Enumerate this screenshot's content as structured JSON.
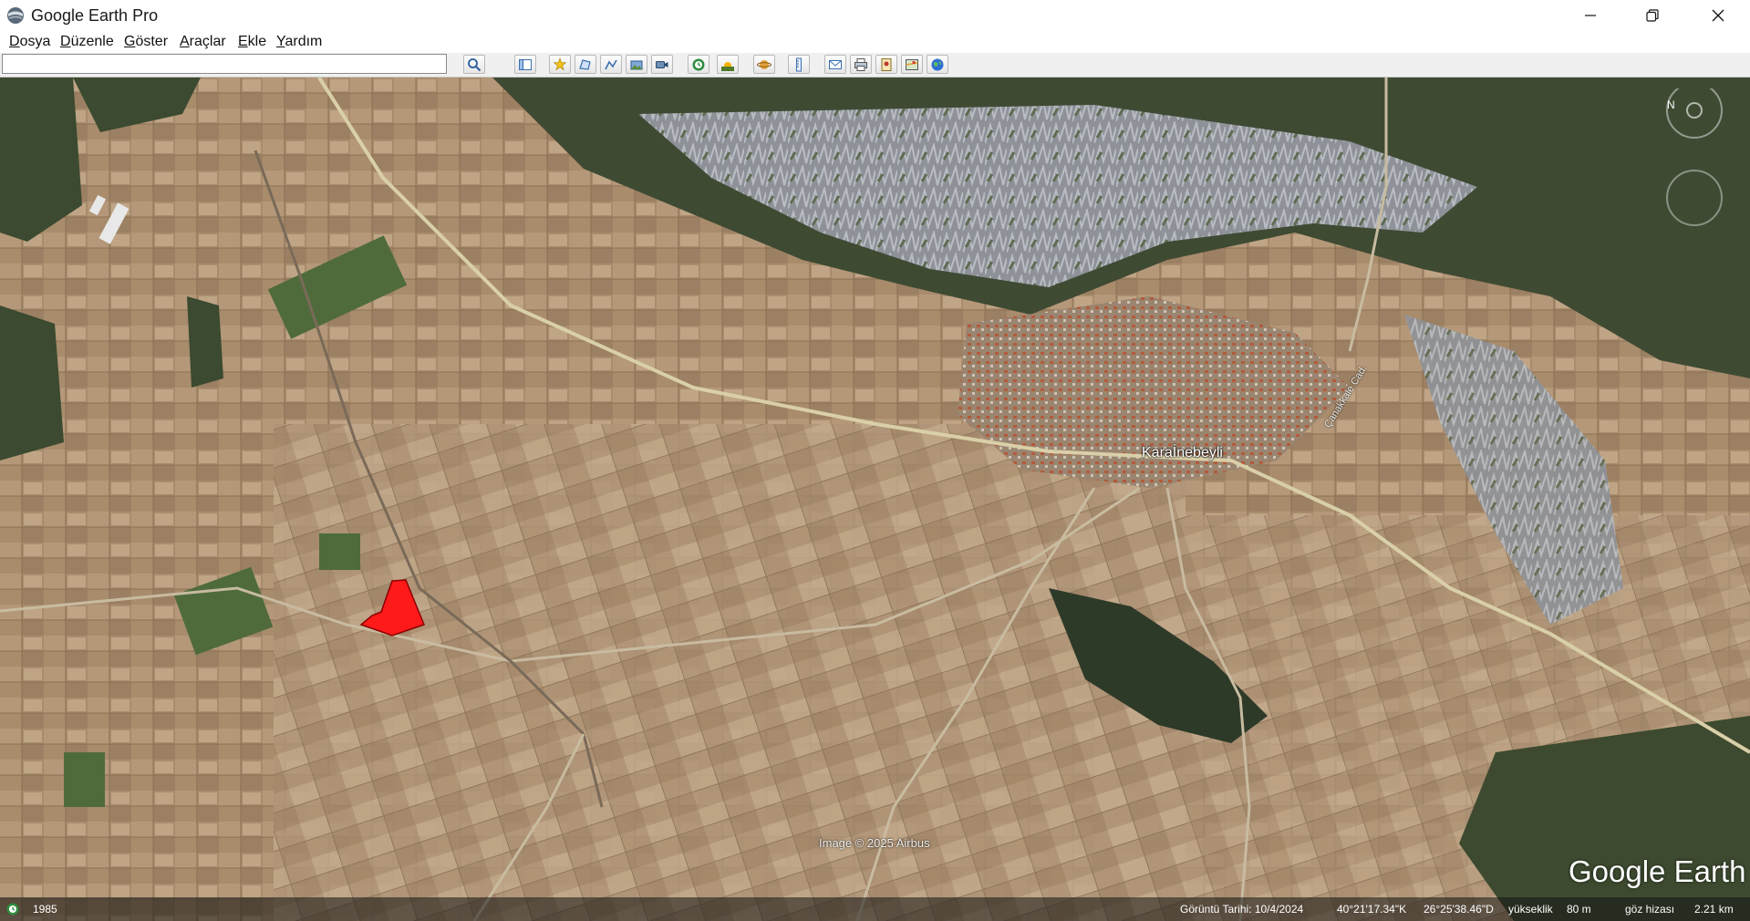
{
  "window": {
    "title": "Google Earth Pro",
    "icon": "google-earth-app-icon",
    "controls": [
      "minimize-icon",
      "restore-icon",
      "close-icon"
    ]
  },
  "menu": [
    {
      "label": "Dosya",
      "underline": "D",
      "rest": "osya"
    },
    {
      "label": "Düzenle",
      "underline": "D",
      "rest": "üzenle"
    },
    {
      "label": "Göster",
      "underline": "G",
      "rest": "öster"
    },
    {
      "label": "Araçlar",
      "underline": "A",
      "rest": "raçlar"
    },
    {
      "label": "Ekle",
      "underline": "E",
      "rest": "kle"
    },
    {
      "label": "Yardım",
      "underline": "Y",
      "rest": "ardım"
    }
  ],
  "search": {
    "value": "",
    "placeholder": ""
  },
  "toolbar": {
    "buttons": [
      "search-icon",
      "sidebar-toggle-icon",
      "add-placemark-icon",
      "add-polygon-icon",
      "add-path-icon",
      "add-image-overlay-icon",
      "record-tour-icon",
      "historical-imagery-icon",
      "sunlight-icon",
      "switch-planet-icon",
      "ruler-icon",
      "email-icon",
      "print-icon",
      "save-image-icon",
      "view-in-maps-icon",
      "earth-icon"
    ]
  },
  "map": {
    "place_label": "Karaİnebeyli",
    "road_label": "Çanakkale Cad.",
    "image_credit": "Image © 2025 Airbus",
    "logo": "Google Earth",
    "polygon_color": "#ff1a1a"
  },
  "status": {
    "history_year": "1985",
    "imagery_date": "Görüntü Tarihi: 10/4/2024",
    "latitude": "40°21'17.34\"K",
    "longitude": "26°25'38.46\"D",
    "elevation_label": "yükseklik",
    "elevation_value": "80 m",
    "eye_label": "göz hizası",
    "eye_value": "2.21 km"
  }
}
